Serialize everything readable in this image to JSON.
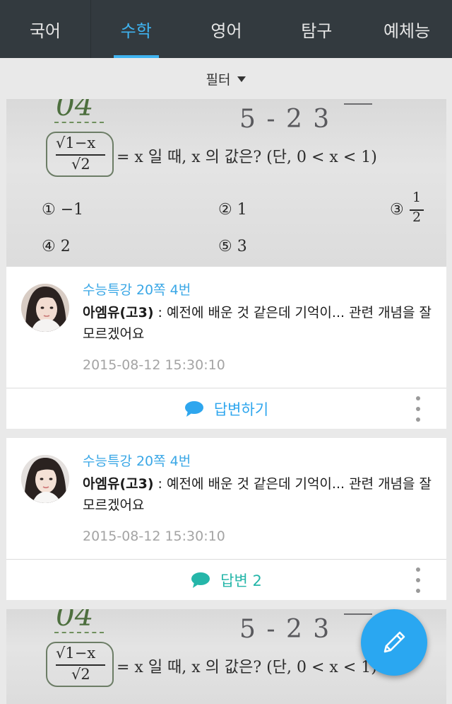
{
  "tabs": [
    {
      "label": "국어",
      "active": false
    },
    {
      "label": "수학",
      "active": true
    },
    {
      "label": "영어",
      "active": false
    },
    {
      "label": "탐구",
      "active": false
    },
    {
      "label": "예체능",
      "active": false
    }
  ],
  "filter": {
    "label": "필터"
  },
  "problem_image": {
    "number": "04",
    "handwriting": "5 - 2   3",
    "fraction_num": "√1−x",
    "fraction_den": "√2",
    "question": "= x 일 때, x 의 값은? (단, 0 < x < 1)",
    "choices": [
      "① −1",
      "② 1",
      "③",
      "④ 2",
      "⑤ 3"
    ],
    "choice3_num": "1",
    "choice3_den": "2"
  },
  "posts": [
    {
      "source": "수능특강 20쪽 4번",
      "author": "아엠유(고3)",
      "text": " : 예전에 배운 것 같은데 기억이... 관련 개념을 잘 모르겠어요",
      "time": "2015-08-12 15:30:10",
      "action_label": "답변하기",
      "action_color": "#2ea6ee"
    },
    {
      "source": "수능특강 20쪽 4번",
      "author": "아엠유(고3)",
      "text": " : 예전에 배운 것 같은데 기억이... 관련 개념을 잘 모르겠어요",
      "time": "2015-08-12 15:30:10",
      "action_label": "답변 2",
      "action_color": "#25b6a9"
    }
  ],
  "fab": {
    "icon": "pencil-icon"
  },
  "icons": {
    "filter_caret": "caret-down-icon",
    "comment": "comment-bubble-icon",
    "more": "more-vertical-icon"
  }
}
